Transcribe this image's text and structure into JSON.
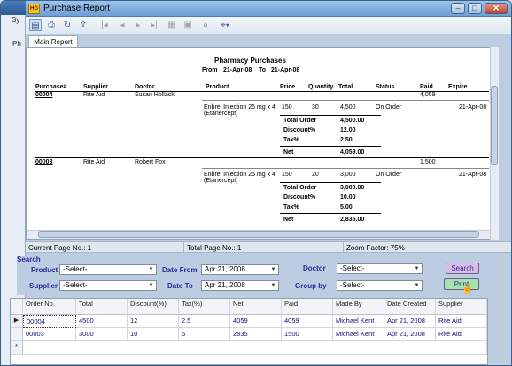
{
  "window": {
    "title": "Purchase Report",
    "app_icon_text": "HG"
  },
  "background_app": {
    "menu1": "Sy",
    "menu2": "Ph"
  },
  "toolbar": {
    "icons": [
      "page-setup-icon",
      "print-icon",
      "refresh-icon",
      "export-icon",
      "first-page-icon",
      "prev-page-icon",
      "next-page-icon",
      "last-page-icon",
      "grid-icon",
      "group-tree-icon",
      "find-icon",
      "zoom-icon"
    ]
  },
  "tab": {
    "label": "Main Report"
  },
  "report": {
    "title": "Pharmacy Purchases",
    "range_from_label": "From",
    "range_from": "21-Apr-08",
    "range_to_label": "To",
    "range_to": "21-Apr-08",
    "headers": [
      "Purchase#",
      "Supplier",
      "Doctor",
      "Product",
      "Price",
      "Quantity",
      "Total",
      "Status",
      "Paid",
      "Expire"
    ],
    "groups": [
      {
        "purchase_no": "00004",
        "supplier": "Rite Aid",
        "doctor": "Susan Hollack",
        "paid": "4,059",
        "product_line1": "Enbrel Injection 25 mg x 4",
        "product_line2": "(Etanercept)",
        "price": "150",
        "quantity": "30",
        "total": "4,500",
        "status": "On Order",
        "expire": "21-Apr-08",
        "total_order_label": "Total Order",
        "total_order": "4,500.00",
        "discount_label": "Discount%",
        "discount": "12.00",
        "tax_label": "Tax%",
        "tax": "2.50",
        "net_label": "Net",
        "net": "4,059.00"
      },
      {
        "purchase_no": "00003",
        "supplier": "Rite Aid",
        "doctor": "Robert Fox",
        "paid": "1,500",
        "product_line1": "Enbrel Injection 25 mg x 4",
        "product_line2": "(Etanercept)",
        "price": "150",
        "quantity": "20",
        "total": "3,000",
        "status": "On Order",
        "expire": "21-Apr-08",
        "total_order_label": "Total Order",
        "total_order": "3,000.00",
        "discount_label": "Discount%",
        "discount": "10.00",
        "tax_label": "Tax%",
        "tax": "5.00",
        "net_label": "Net",
        "net": "2,835.00"
      }
    ]
  },
  "status_bar": {
    "current_page": "Current Page No.: 1",
    "total_page": "Total Page No.: 1",
    "zoom": "Zoom Factor: 75%"
  },
  "search": {
    "title": "Search",
    "product_label": "Product",
    "product_value": "-Select-",
    "date_from_label": "Date From",
    "date_from_value": "Apr 21, 2008",
    "doctor_label": "Doctor",
    "doctor_value": "-Select-",
    "search_button": "Search",
    "supplier_label": "Supplier",
    "supplier_value": "-Select-",
    "date_to_label": "Date To",
    "date_to_value": "Apr 21, 2008",
    "group_by_label": "Group by",
    "group_by_value": "-Select-",
    "print_button": "Print"
  },
  "grid": {
    "columns": [
      "Order No.",
      "Total",
      "Discount(%)",
      "Tax(%)",
      "Net",
      "Paid",
      "Made By",
      "Date Created",
      "Supplier"
    ],
    "rows": [
      [
        "00004",
        "4500",
        "12",
        "2.5",
        "4059",
        "4059",
        "Michael Kent",
        "Apr 21, 2008",
        "Rite Aid"
      ],
      [
        "00003",
        "3000",
        "10",
        "5",
        "2835",
        "1500",
        "Michael Kent",
        "Apr 21, 2008",
        "Rite Aid"
      ]
    ],
    "row_markers": [
      "▶",
      "",
      "*"
    ]
  },
  "colors": {
    "accent_title": "#2b2b9a",
    "search_button": "#d9b8e6",
    "print_button": "#9be0a4"
  }
}
